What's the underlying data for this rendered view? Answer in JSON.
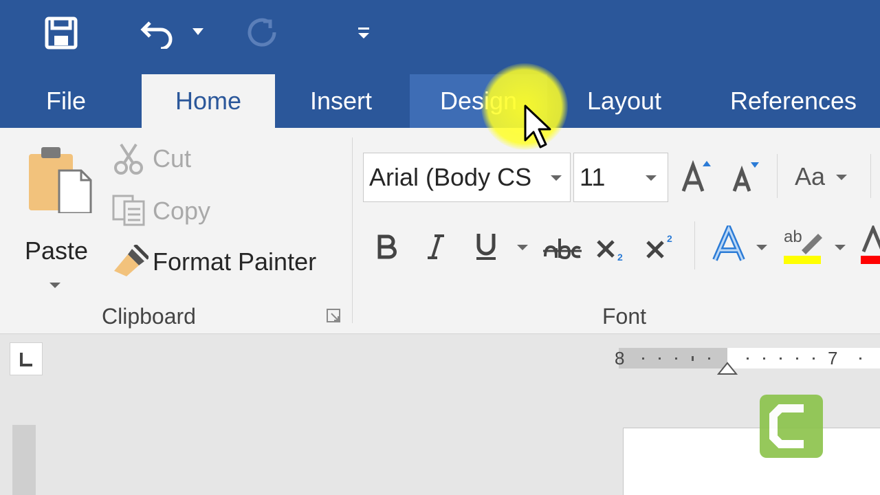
{
  "qat": {
    "icons": [
      "save-icon",
      "undo-icon",
      "redo-icon",
      "customize-qat-icon"
    ]
  },
  "tabs": [
    {
      "label": "File"
    },
    {
      "label": "Home"
    },
    {
      "label": "Insert"
    },
    {
      "label": "Design"
    },
    {
      "label": "Layout"
    },
    {
      "label": "References"
    }
  ],
  "clipboard": {
    "paste_label": "Paste",
    "cut_label": "Cut",
    "copy_label": "Copy",
    "format_painter_label": "Format Painter",
    "group_label": "Clipboard"
  },
  "font": {
    "font_name": "Arial (Body CS",
    "font_size": "11",
    "change_case_label": "Aa",
    "group_label": "Font",
    "highlight_color": "#ffff00",
    "font_color": "#ff0000"
  },
  "ruler": {
    "left_number": "8",
    "right_number": "7"
  },
  "colors": {
    "titlebar": "#2b579a",
    "ribbon": "#f3f3f3",
    "accent": "#2b579a"
  }
}
